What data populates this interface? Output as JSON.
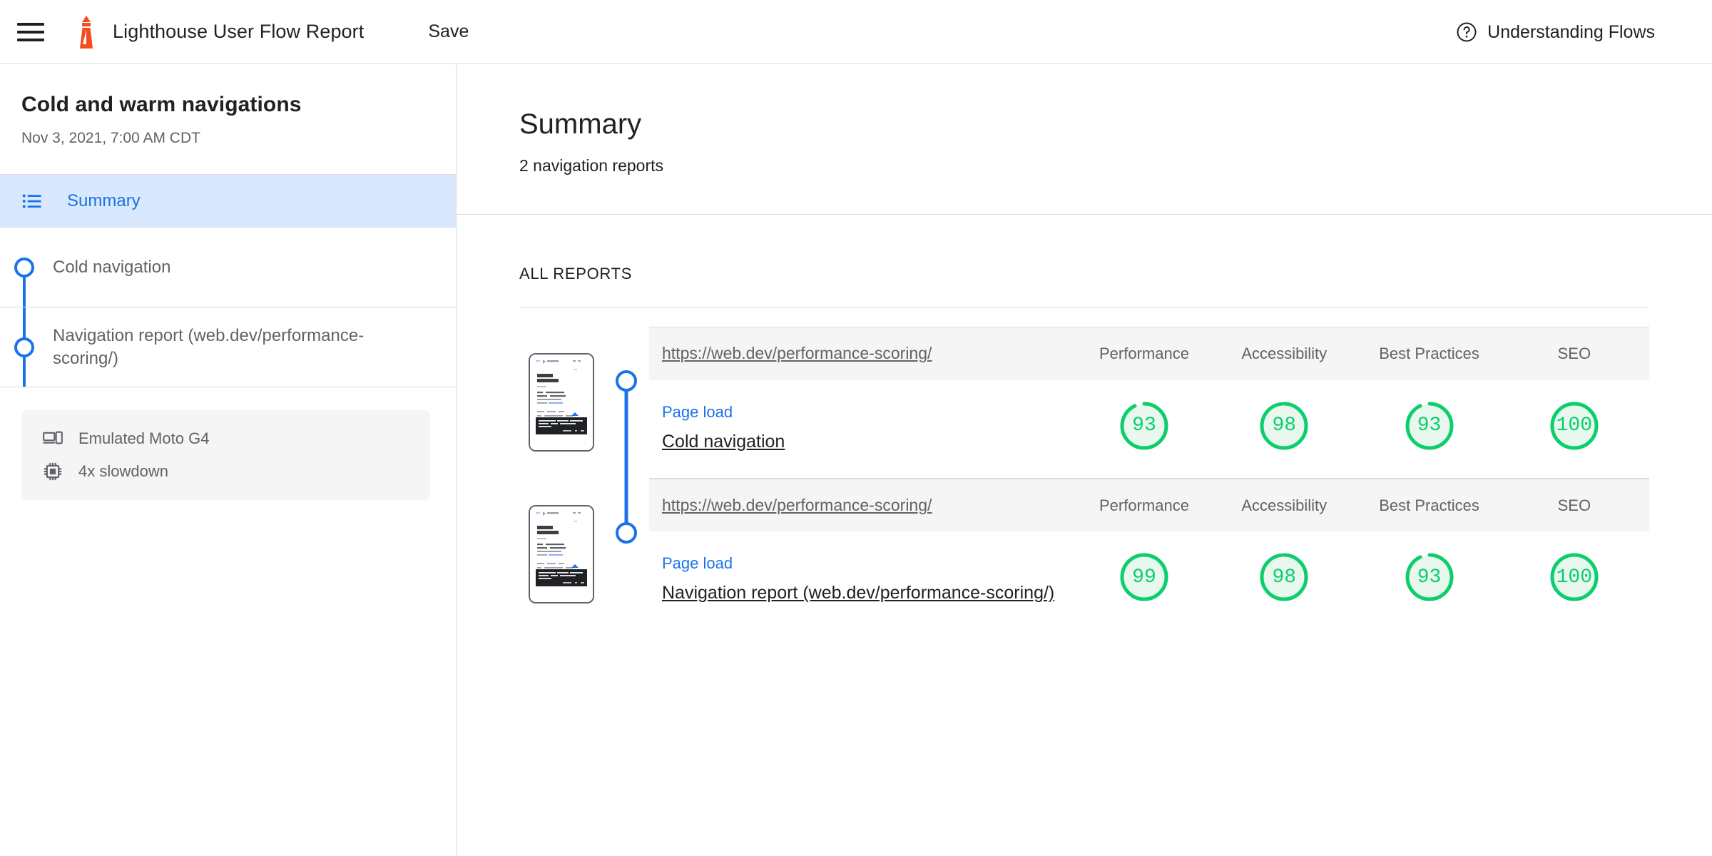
{
  "topbar": {
    "menu_icon": "hamburger-menu-icon",
    "logo_icon": "lighthouse-logo-icon",
    "title": "Lighthouse User Flow Report",
    "save_label": "Save",
    "help_icon": "help-circle-icon",
    "help_label": "Understanding Flows"
  },
  "sidebar": {
    "flow_title": "Cold and warm navigations",
    "flow_date": "Nov 3, 2021, 7:00 AM CDT",
    "summary": {
      "icon": "list-icon",
      "label": "Summary"
    },
    "steps": [
      {
        "label": "Cold navigation"
      },
      {
        "label": "Navigation report (web.dev/performance-scoring/)"
      }
    ],
    "environment": [
      {
        "icon": "devices-icon",
        "text": "Emulated Moto G4"
      },
      {
        "icon": "cpu-chip-icon",
        "text": "4x slowdown"
      }
    ]
  },
  "main": {
    "title": "Summary",
    "subtitle": "2 navigation reports",
    "section_label": "ALL REPORTS",
    "columns": [
      "Performance",
      "Accessibility",
      "Best Practices",
      "SEO"
    ],
    "reports": [
      {
        "url": "https://web.dev/performance-scoring/",
        "gate": "Page load",
        "name": "Cold navigation",
        "scores": [
          93,
          98,
          93,
          100
        ]
      },
      {
        "url": "https://web.dev/performance-scoring/",
        "gate": "Page load",
        "name": "Navigation report (web.dev/performance-scoring/)",
        "scores": [
          99,
          98,
          93,
          100
        ]
      }
    ]
  },
  "colors": {
    "accent_blue": "#1a73e8",
    "score_green": "#0cce6b",
    "score_green_bg": "#e8f8ef",
    "lighthouse_orange": "#f44b21",
    "text_primary": "#202124",
    "text_secondary": "#5f6368",
    "divider": "#dadce0",
    "summary_highlight": "#d9e8fd"
  }
}
